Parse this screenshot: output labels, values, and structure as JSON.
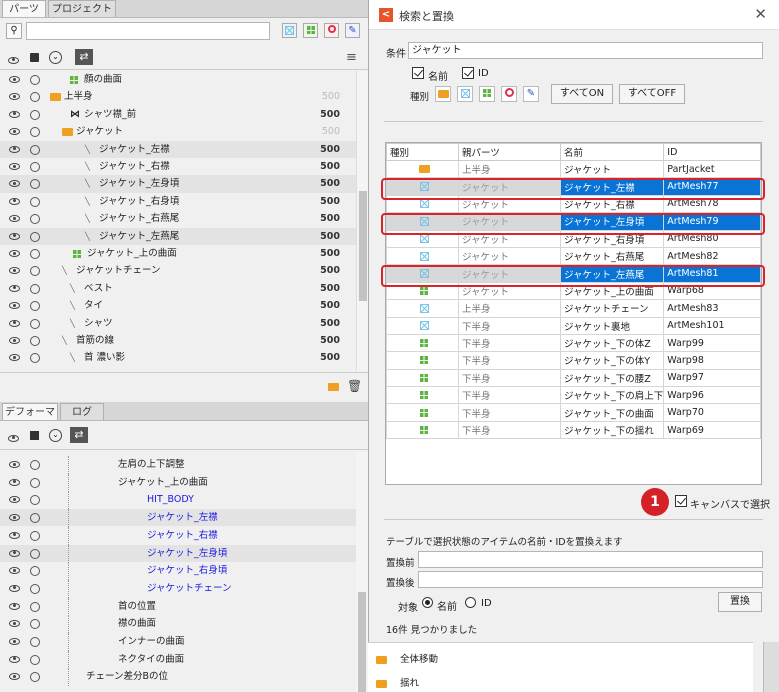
{
  "parts_panel": {
    "tabs": [
      "パーツ",
      "プロジェクト"
    ],
    "rows": [
      {
        "label": "顔の曲面",
        "icon": "warp",
        "indent": 70,
        "value": "",
        "selected": false
      },
      {
        "label": "上半身",
        "icon": "folder",
        "indent": 50,
        "value": "500",
        "dim": true,
        "selected": false
      },
      {
        "label": "シャツ襟_前",
        "icon": "shirt",
        "indent": 70,
        "value": "500",
        "selected": false
      },
      {
        "label": "ジャケット",
        "icon": "folder",
        "indent": 62,
        "value": "500",
        "dim": true,
        "selected": false
      },
      {
        "label": "ジャケット_左襟",
        "icon": "line",
        "indent": 85,
        "value": "500",
        "selected": true
      },
      {
        "label": "ジャケット_右襟",
        "icon": "line",
        "indent": 85,
        "value": "500",
        "selected": false
      },
      {
        "label": "ジャケット_左身頃",
        "icon": "line",
        "indent": 85,
        "value": "500",
        "selected": true
      },
      {
        "label": "ジャケット_右身頃",
        "icon": "line",
        "indent": 85,
        "value": "500",
        "selected": false
      },
      {
        "label": "ジャケット_右燕尾",
        "icon": "line",
        "indent": 85,
        "value": "500",
        "selected": false
      },
      {
        "label": "ジャケット_左燕尾",
        "icon": "line",
        "indent": 85,
        "value": "500",
        "selected": true
      },
      {
        "label": "ジャケット_上の曲面",
        "icon": "warp",
        "indent": 73,
        "value": "500",
        "selected": false
      },
      {
        "label": "ジャケットチェーン",
        "icon": "line",
        "indent": 62,
        "value": "500",
        "selected": false
      },
      {
        "label": "ベスト",
        "icon": "line",
        "indent": 70,
        "value": "500",
        "selected": false
      },
      {
        "label": "タイ",
        "icon": "line",
        "indent": 70,
        "value": "500",
        "selected": false
      },
      {
        "label": "シャツ",
        "icon": "line",
        "indent": 70,
        "value": "500",
        "selected": false
      },
      {
        "label": "首筋の線",
        "icon": "line",
        "indent": 62,
        "value": "500",
        "selected": false
      },
      {
        "label": "首 濃い影",
        "icon": "line",
        "indent": 70,
        "value": "500",
        "selected": false
      }
    ]
  },
  "deformer_panel": {
    "tabs": [
      "デフォーマ",
      "ログ"
    ],
    "rows": [
      {
        "label": "左肩の上下調整",
        "indent": 118,
        "blue": false,
        "selected": false
      },
      {
        "label": "ジャケット_上の曲面",
        "indent": 118,
        "blue": false,
        "selected": false
      },
      {
        "label": "HIT_BODY",
        "indent": 147,
        "blue": true,
        "selected": false
      },
      {
        "label": "ジャケット_左襟",
        "indent": 147,
        "blue": true,
        "selected": true
      },
      {
        "label": "ジャケット_右襟",
        "indent": 147,
        "blue": true,
        "selected": false
      },
      {
        "label": "ジャケット_左身頃",
        "indent": 147,
        "blue": true,
        "selected": true
      },
      {
        "label": "ジャケット_右身頃",
        "indent": 147,
        "blue": true,
        "selected": false
      },
      {
        "label": "ジャケットチェーン",
        "indent": 147,
        "blue": true,
        "selected": false
      },
      {
        "label": "首の位置",
        "indent": 118,
        "blue": false,
        "selected": false
      },
      {
        "label": "襟の曲面",
        "indent": 118,
        "blue": false,
        "selected": false
      },
      {
        "label": "インナーの曲面",
        "indent": 118,
        "blue": false,
        "selected": false
      },
      {
        "label": "ネクタイの曲面",
        "indent": 118,
        "blue": false,
        "selected": false
      },
      {
        "label": "チェーン差分Bの位",
        "indent": 86,
        "blue": false,
        "selected": false
      }
    ]
  },
  "dialog": {
    "title": "検索と置換",
    "condition_label": "条件",
    "condition_value": "ジャケット",
    "name_check": "名前",
    "id_check": "ID",
    "kind_label": "種別",
    "all_on": "すべてON",
    "all_off": "すべてOFF",
    "columns": [
      "種別",
      "親パーツ",
      "名前",
      "ID"
    ],
    "results": [
      {
        "icon": "folder",
        "parent": "上半身",
        "name": "ジャケット",
        "id": "PartJacket",
        "selected": false
      },
      {
        "icon": "art",
        "parent": "ジャケット",
        "name": "ジャケット_左襟",
        "id": "ArtMesh77",
        "selected": true
      },
      {
        "icon": "art",
        "parent": "ジャケット",
        "name": "ジャケット_右襟",
        "id": "ArtMesh78",
        "selected": false
      },
      {
        "icon": "art",
        "parent": "ジャケット",
        "name": "ジャケット_左身頃",
        "id": "ArtMesh79",
        "selected": true
      },
      {
        "icon": "art",
        "parent": "ジャケット",
        "name": "ジャケット_右身頃",
        "id": "ArtMesh80",
        "selected": false
      },
      {
        "icon": "art",
        "parent": "ジャケット",
        "name": "ジャケット_右燕尾",
        "id": "ArtMesh82",
        "selected": false
      },
      {
        "icon": "art",
        "parent": "ジャケット",
        "name": "ジャケット_左燕尾",
        "id": "ArtMesh81",
        "selected": true
      },
      {
        "icon": "warp",
        "parent": "ジャケット",
        "name": "ジャケット_上の曲面",
        "id": "Warp68",
        "selected": false
      },
      {
        "icon": "art",
        "parent": "上半身",
        "name": "ジャケットチェーン",
        "id": "ArtMesh83",
        "selected": false
      },
      {
        "icon": "art",
        "parent": "下半身",
        "name": "ジャケット裏地",
        "id": "ArtMesh101",
        "selected": false
      },
      {
        "icon": "warp",
        "parent": "下半身",
        "name": "ジャケット_下の体Z",
        "id": "Warp99",
        "selected": false
      },
      {
        "icon": "warp",
        "parent": "下半身",
        "name": "ジャケット_下の体Y",
        "id": "Warp98",
        "selected": false
      },
      {
        "icon": "warp",
        "parent": "下半身",
        "name": "ジャケット_下の腰Z",
        "id": "Warp97",
        "selected": false
      },
      {
        "icon": "warp",
        "parent": "下半身",
        "name": "ジャケット_下の肩上下",
        "id": "Warp96",
        "selected": false
      },
      {
        "icon": "warp",
        "parent": "下半身",
        "name": "ジャケット_下の曲面",
        "id": "Warp70",
        "selected": false
      },
      {
        "icon": "warp",
        "parent": "下半身",
        "name": "ジャケット_下の揺れ",
        "id": "Warp69",
        "selected": false
      }
    ],
    "canvas_select_label": "キャンバスで選択",
    "badge": "1",
    "replace_desc": "テーブルで選択状態のアイテムの名前・IDを置換えます",
    "before_label": "置換前",
    "after_label": "置換後",
    "target_label": "対象",
    "target_name": "名前",
    "target_id": "ID",
    "replace_button": "置換",
    "found_text": "16件 見つかりました",
    "bottom_items": [
      "全体移動",
      "揺れ"
    ]
  }
}
